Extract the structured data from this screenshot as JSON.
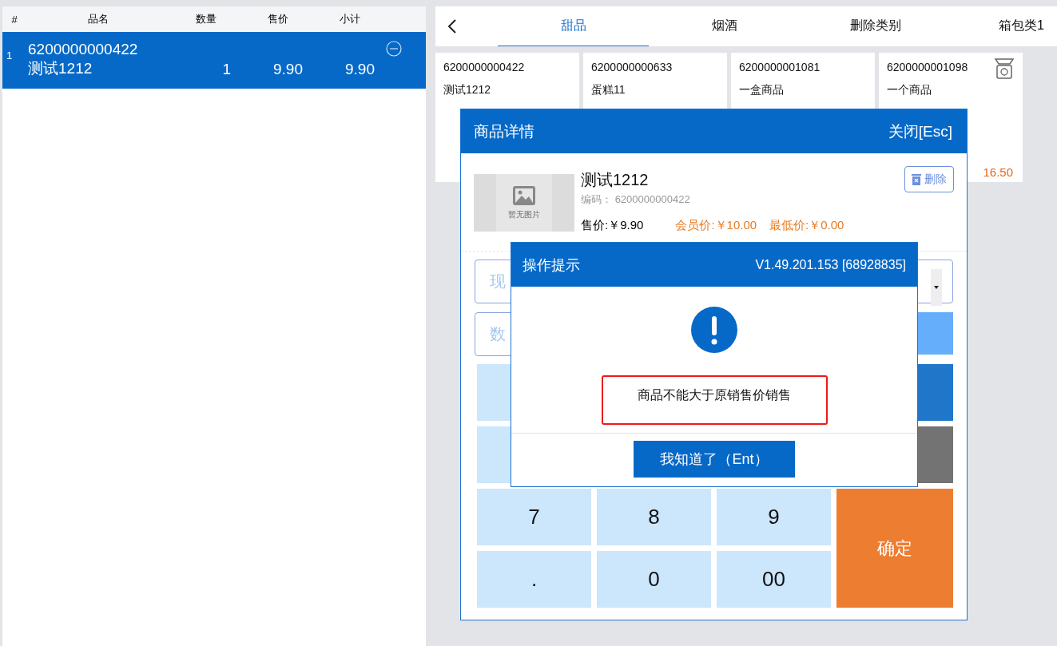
{
  "cart": {
    "columns": [
      "#",
      "品名",
      "数量",
      "售价",
      "小计"
    ],
    "rows": [
      {
        "index": "1",
        "code": "6200000000422",
        "name": "测试1212",
        "qty": "1",
        "price": "9.90",
        "subtotal": "9.90",
        "selected": true
      }
    ]
  },
  "category_tabs": [
    {
      "label": "甜品",
      "selected": true
    },
    {
      "label": "烟酒",
      "selected": false
    },
    {
      "label": "删除类别",
      "selected": false
    },
    {
      "label": "箱包类1",
      "selected": false
    }
  ],
  "products": [
    {
      "code": "6200000000422",
      "name": "测试1212",
      "weighed": false
    },
    {
      "code": "6200000000633",
      "name": "蛋糕11",
      "weighed": false
    },
    {
      "code": "6200000001081",
      "name": "一盒商品",
      "weighed": false
    },
    {
      "code": "6200000001098",
      "name": "一个商品",
      "weighed": true,
      "price": "16.50"
    }
  ],
  "detail_dialog": {
    "title": "商品详情",
    "close": "关闭[Esc]",
    "image_placeholder": "暂无图片",
    "name": "测试1212",
    "code_label": "编码：",
    "code": "6200000000422",
    "delete": "删除",
    "sale_price": "售价:￥9.90",
    "member_price": "会员价:￥10.00",
    "min_price": "最低价:￥0.00",
    "price_field": "现",
    "qty_field": "数",
    "keypad": [
      {
        "kind": "digit"
      },
      {
        "kind": "primary"
      },
      {
        "kind": "digit"
      },
      {
        "kind": "muted"
      },
      {
        "kind": "digit",
        "label": "7"
      },
      {
        "kind": "digit",
        "label": "8"
      },
      {
        "kind": "digit",
        "label": "9"
      },
      {
        "kind": "confirm",
        "label": "确定"
      },
      {
        "kind": "digit",
        "label": "."
      },
      {
        "kind": "digit",
        "label": "0"
      },
      {
        "kind": "digit",
        "label": "00"
      }
    ]
  },
  "alert_dialog": {
    "title": "操作提示",
    "version": "V1.49.201.153 [68928835]",
    "message": "商品不能大于原销售价销售",
    "button": "我知道了（Ent）"
  }
}
